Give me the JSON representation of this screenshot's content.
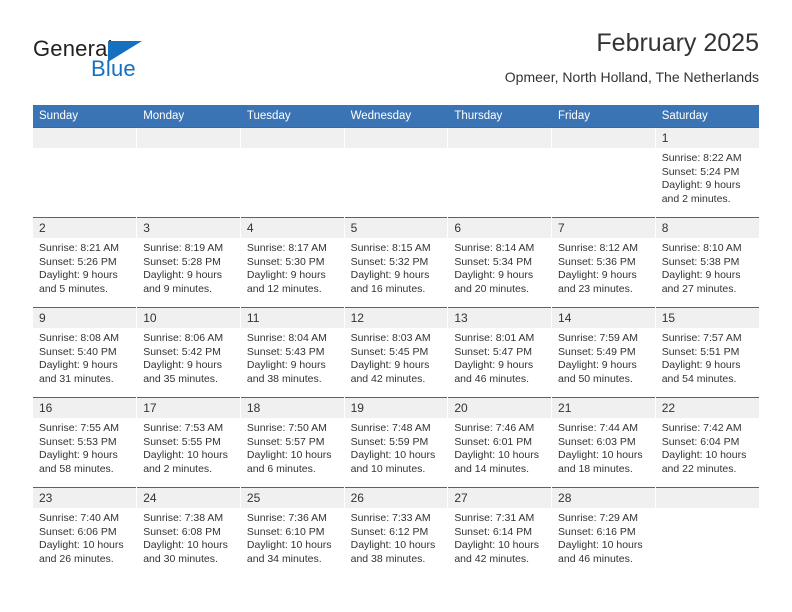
{
  "brand": {
    "name_part1": "General",
    "name_part2": "Blue",
    "triangle_color": "#1670c0",
    "icon": "triangle-flag-icon"
  },
  "header": {
    "title": "February 2025",
    "subtitle": "Opmeer, North Holland, The Netherlands"
  },
  "theme": {
    "header_blue": "#3b74b4",
    "daynum_gray": "#f0f0f0",
    "text": "#333333"
  },
  "calendar": {
    "weekday_headers": [
      "Sunday",
      "Monday",
      "Tuesday",
      "Wednesday",
      "Thursday",
      "Friday",
      "Saturday"
    ],
    "labels": {
      "sunrise": "Sunrise:",
      "sunset": "Sunset:",
      "daylight": "Daylight:"
    },
    "weeks": [
      [
        {
          "day": "",
          "empty": true
        },
        {
          "day": "",
          "empty": true
        },
        {
          "day": "",
          "empty": true
        },
        {
          "day": "",
          "empty": true
        },
        {
          "day": "",
          "empty": true
        },
        {
          "day": "",
          "empty": true
        },
        {
          "day": "1",
          "sunrise": "Sunrise: 8:22 AM",
          "sunset": "Sunset: 5:24 PM",
          "daylight": "Daylight: 9 hours and 2 minutes."
        }
      ],
      [
        {
          "day": "2",
          "sunrise": "Sunrise: 8:21 AM",
          "sunset": "Sunset: 5:26 PM",
          "daylight": "Daylight: 9 hours and 5 minutes."
        },
        {
          "day": "3",
          "sunrise": "Sunrise: 8:19 AM",
          "sunset": "Sunset: 5:28 PM",
          "daylight": "Daylight: 9 hours and 9 minutes."
        },
        {
          "day": "4",
          "sunrise": "Sunrise: 8:17 AM",
          "sunset": "Sunset: 5:30 PM",
          "daylight": "Daylight: 9 hours and 12 minutes."
        },
        {
          "day": "5",
          "sunrise": "Sunrise: 8:15 AM",
          "sunset": "Sunset: 5:32 PM",
          "daylight": "Daylight: 9 hours and 16 minutes."
        },
        {
          "day": "6",
          "sunrise": "Sunrise: 8:14 AM",
          "sunset": "Sunset: 5:34 PM",
          "daylight": "Daylight: 9 hours and 20 minutes."
        },
        {
          "day": "7",
          "sunrise": "Sunrise: 8:12 AM",
          "sunset": "Sunset: 5:36 PM",
          "daylight": "Daylight: 9 hours and 23 minutes."
        },
        {
          "day": "8",
          "sunrise": "Sunrise: 8:10 AM",
          "sunset": "Sunset: 5:38 PM",
          "daylight": "Daylight: 9 hours and 27 minutes."
        }
      ],
      [
        {
          "day": "9",
          "sunrise": "Sunrise: 8:08 AM",
          "sunset": "Sunset: 5:40 PM",
          "daylight": "Daylight: 9 hours and 31 minutes."
        },
        {
          "day": "10",
          "sunrise": "Sunrise: 8:06 AM",
          "sunset": "Sunset: 5:42 PM",
          "daylight": "Daylight: 9 hours and 35 minutes."
        },
        {
          "day": "11",
          "sunrise": "Sunrise: 8:04 AM",
          "sunset": "Sunset: 5:43 PM",
          "daylight": "Daylight: 9 hours and 38 minutes."
        },
        {
          "day": "12",
          "sunrise": "Sunrise: 8:03 AM",
          "sunset": "Sunset: 5:45 PM",
          "daylight": "Daylight: 9 hours and 42 minutes."
        },
        {
          "day": "13",
          "sunrise": "Sunrise: 8:01 AM",
          "sunset": "Sunset: 5:47 PM",
          "daylight": "Daylight: 9 hours and 46 minutes."
        },
        {
          "day": "14",
          "sunrise": "Sunrise: 7:59 AM",
          "sunset": "Sunset: 5:49 PM",
          "daylight": "Daylight: 9 hours and 50 minutes."
        },
        {
          "day": "15",
          "sunrise": "Sunrise: 7:57 AM",
          "sunset": "Sunset: 5:51 PM",
          "daylight": "Daylight: 9 hours and 54 minutes."
        }
      ],
      [
        {
          "day": "16",
          "sunrise": "Sunrise: 7:55 AM",
          "sunset": "Sunset: 5:53 PM",
          "daylight": "Daylight: 9 hours and 58 minutes."
        },
        {
          "day": "17",
          "sunrise": "Sunrise: 7:53 AM",
          "sunset": "Sunset: 5:55 PM",
          "daylight": "Daylight: 10 hours and 2 minutes."
        },
        {
          "day": "18",
          "sunrise": "Sunrise: 7:50 AM",
          "sunset": "Sunset: 5:57 PM",
          "daylight": "Daylight: 10 hours and 6 minutes."
        },
        {
          "day": "19",
          "sunrise": "Sunrise: 7:48 AM",
          "sunset": "Sunset: 5:59 PM",
          "daylight": "Daylight: 10 hours and 10 minutes."
        },
        {
          "day": "20",
          "sunrise": "Sunrise: 7:46 AM",
          "sunset": "Sunset: 6:01 PM",
          "daylight": "Daylight: 10 hours and 14 minutes."
        },
        {
          "day": "21",
          "sunrise": "Sunrise: 7:44 AM",
          "sunset": "Sunset: 6:03 PM",
          "daylight": "Daylight: 10 hours and 18 minutes."
        },
        {
          "day": "22",
          "sunrise": "Sunrise: 7:42 AM",
          "sunset": "Sunset: 6:04 PM",
          "daylight": "Daylight: 10 hours and 22 minutes."
        }
      ],
      [
        {
          "day": "23",
          "sunrise": "Sunrise: 7:40 AM",
          "sunset": "Sunset: 6:06 PM",
          "daylight": "Daylight: 10 hours and 26 minutes."
        },
        {
          "day": "24",
          "sunrise": "Sunrise: 7:38 AM",
          "sunset": "Sunset: 6:08 PM",
          "daylight": "Daylight: 10 hours and 30 minutes."
        },
        {
          "day": "25",
          "sunrise": "Sunrise: 7:36 AM",
          "sunset": "Sunset: 6:10 PM",
          "daylight": "Daylight: 10 hours and 34 minutes."
        },
        {
          "day": "26",
          "sunrise": "Sunrise: 7:33 AM",
          "sunset": "Sunset: 6:12 PM",
          "daylight": "Daylight: 10 hours and 38 minutes."
        },
        {
          "day": "27",
          "sunrise": "Sunrise: 7:31 AM",
          "sunset": "Sunset: 6:14 PM",
          "daylight": "Daylight: 10 hours and 42 minutes."
        },
        {
          "day": "28",
          "sunrise": "Sunrise: 7:29 AM",
          "sunset": "Sunset: 6:16 PM",
          "daylight": "Daylight: 10 hours and 46 minutes."
        },
        {
          "day": "",
          "empty": true
        }
      ]
    ]
  }
}
